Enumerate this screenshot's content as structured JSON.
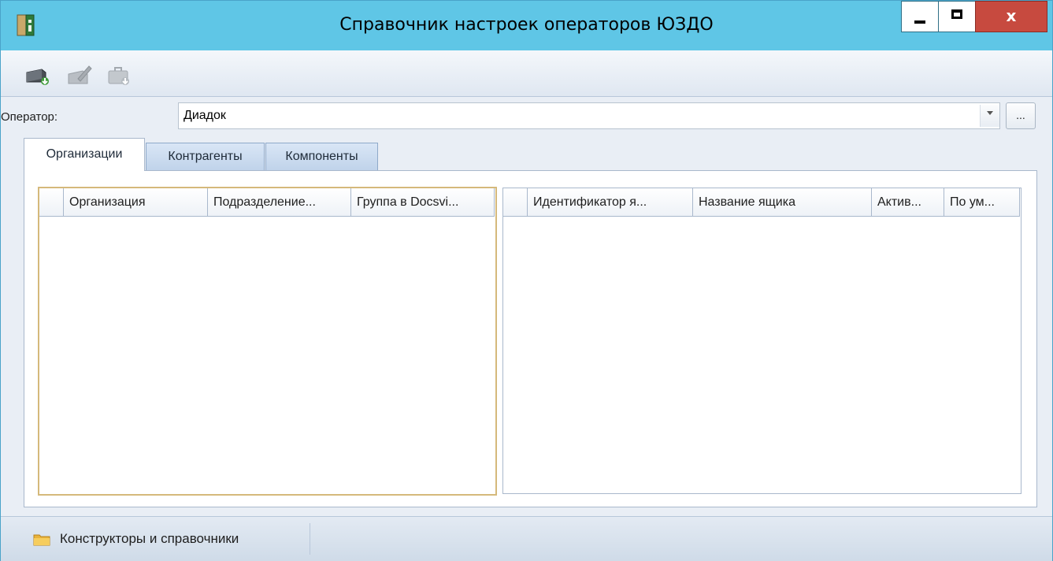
{
  "window": {
    "title": "Справочник настроек операторов ЮЗДО",
    "controls": {
      "minimize": "minimize",
      "maximize": "maximize",
      "close": "x"
    }
  },
  "toolbar": {
    "buttons": [
      "import-icon",
      "edit-icon",
      "export-icon"
    ]
  },
  "operator": {
    "label": "Оператор:",
    "value": "Диадок",
    "more_label": "..."
  },
  "tabs": [
    {
      "label": "Организации",
      "active": true
    },
    {
      "label": "Контрагенты",
      "active": false
    },
    {
      "label": "Компоненты",
      "active": false
    }
  ],
  "left_grid": {
    "columns": [
      "Организация",
      "Подразделение...",
      "Группа в Docsvi..."
    ]
  },
  "right_grid": {
    "columns": [
      "Идентификатор я...",
      "Название ящика",
      "Актив...",
      "По ум..."
    ]
  },
  "statusbar": {
    "item": "Конструкторы и справочники"
  },
  "colors": {
    "titlebar": "#5fc6e6",
    "close_button": "#c74a3f",
    "focus_border": "#d5b97b"
  }
}
